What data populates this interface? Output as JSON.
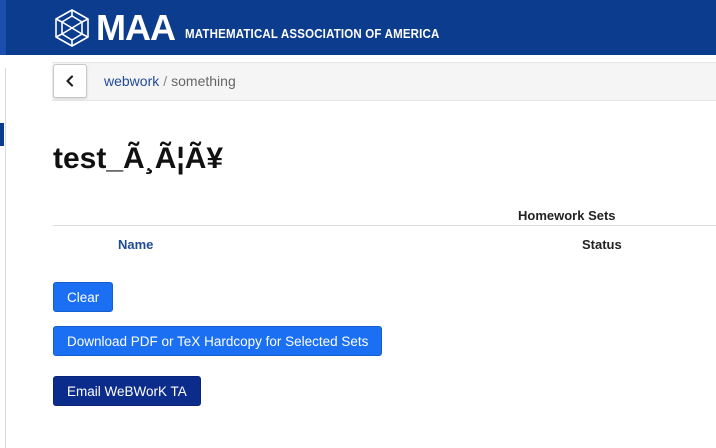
{
  "header": {
    "logo_mark": "MAA",
    "logo_full": "MATHEMATICAL ASSOCIATION OF AMERICA",
    "bg_color": "#0c3c8e"
  },
  "breadcrumb": {
    "back_icon": "chevron-left-icon",
    "items": [
      "webwork",
      "something"
    ],
    "separator": "/"
  },
  "page": {
    "title": "test_Ã¸Ã¦Ã¥"
  },
  "table": {
    "caption": "Homework Sets",
    "columns": [
      "Name",
      "Status"
    ]
  },
  "buttons": {
    "clear": "Clear",
    "download": "Download PDF or TeX Hardcopy for Selected Sets",
    "email": "Email WeBWorK TA"
  },
  "colors": {
    "primary_button": "#1a6ff2",
    "dark_button": "#0c2c8c",
    "link": "#1f4a96"
  }
}
